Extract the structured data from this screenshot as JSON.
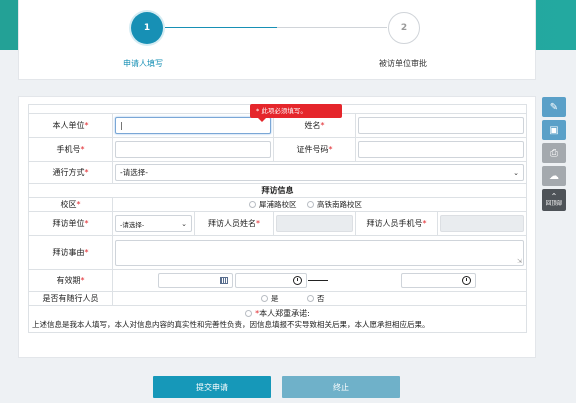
{
  "steps": [
    {
      "number": "1",
      "label": "申请人填写"
    },
    {
      "number": "2",
      "label": "被访单位审批"
    }
  ],
  "tooltip": "* 此项必须填写。",
  "form": {
    "unit_label": "本人单位",
    "name_label": "姓名",
    "phone_label": "手机号",
    "id_label": "证件号码",
    "transport_label": "通行方式",
    "transport_value": "-请选择-",
    "visit_section_title": "拜访信息",
    "campus_label": "校区",
    "campus_options": [
      "犀浦路校区",
      "高铁南路校区"
    ],
    "visit_unit_label": "拜访单位",
    "visit_unit_value": "-请选择-",
    "visitee_name_label": "拜访人员姓名",
    "visitee_phone_label": "拜访人员手机号",
    "reason_label": "拜访事由",
    "validity_label": "有效期",
    "companion_label": "是否有随行人员",
    "companion_options": [
      "是",
      "否"
    ],
    "promise_title": "本人郑重承诺:",
    "promise_text": "上述信息是我本人填写，本人对信息内容的真实性和完善性负责，因信息填报不实导致相关后果，本人愿承担相应后果。",
    "required_mark": "*"
  },
  "side_tools": {
    "back_to_top": "回顶部"
  },
  "buttons": {
    "submit": "提交申请",
    "stop": "终止"
  },
  "colors": {
    "primary": "#1698b9",
    "band": "#23a196",
    "required": "#e0262b"
  }
}
